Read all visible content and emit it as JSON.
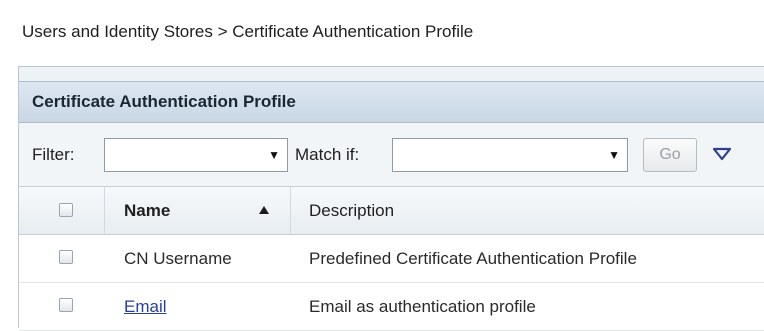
{
  "breadcrumb": "Users and Identity Stores > Certificate Authentication Profile",
  "panel": {
    "title": "Certificate Authentication Profile"
  },
  "filter_bar": {
    "filter_label": "Filter:",
    "filter_value": "",
    "match_label": "Match if:",
    "match_value": "",
    "go_label": "Go"
  },
  "table": {
    "columns": {
      "name": "Name",
      "description": "Description"
    },
    "sort": "ascending",
    "rows": [
      {
        "name": "CN Username",
        "description": "Predefined Certificate Authentication Profile",
        "is_link": false
      },
      {
        "name": "Email",
        "description": "Email as authentication profile",
        "is_link": true
      }
    ]
  },
  "colors": {
    "panel_bg": "#edf2f7",
    "header_bg": "#c9d7e5",
    "link": "#2a3f9c",
    "dropdown_icon": "#2f3f8f"
  },
  "icons": [
    "chevron-down-icon",
    "sort-ascending-icon",
    "filter-menu-icon"
  ]
}
